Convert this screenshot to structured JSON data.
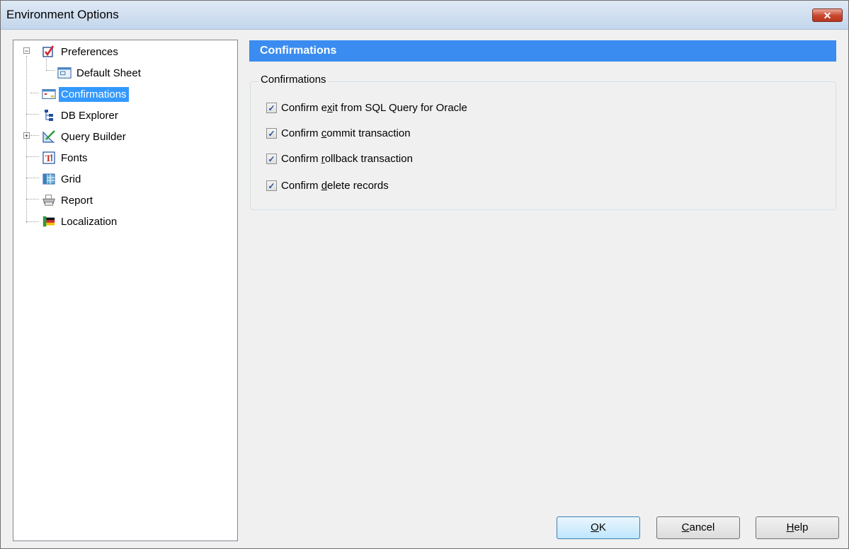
{
  "window": {
    "title": "Environment Options",
    "close_glyph": "✕"
  },
  "tree": {
    "items": [
      {
        "label": "Preferences",
        "icon": "checkbox-form-icon"
      },
      {
        "label": "Default Sheet",
        "icon": "sheet-window-icon"
      },
      {
        "label": "Confirmations",
        "icon": "dialog-icon",
        "selected": true
      },
      {
        "label": "DB Explorer",
        "icon": "tree-structure-icon"
      },
      {
        "label": "Query Builder",
        "icon": "ruler-pencil-icon"
      },
      {
        "label": "Fonts",
        "icon": "font-icon"
      },
      {
        "label": "Grid",
        "icon": "grid-icon"
      },
      {
        "label": "Report",
        "icon": "printer-icon"
      },
      {
        "label": "Localization",
        "icon": "flag-icon"
      }
    ]
  },
  "panel": {
    "header": "Confirmations",
    "group_label": "Confirmations",
    "checkboxes": [
      {
        "pre": "Confirm e",
        "ul": "x",
        "post": "it from SQL Query for Oracle",
        "checked": true
      },
      {
        "pre": "Confirm ",
        "ul": "c",
        "post": "ommit transaction",
        "checked": true
      },
      {
        "pre": "Confirm ",
        "ul": "r",
        "post": "ollback transaction",
        "checked": true
      },
      {
        "pre": "Confirm ",
        "ul": "d",
        "post": "elete records",
        "checked": true
      }
    ]
  },
  "buttons": {
    "ok": {
      "ul": "O",
      "rest": "K"
    },
    "cancel": {
      "ul": "C",
      "rest": "ancel"
    },
    "help": {
      "ul": "H",
      "rest": "elp"
    }
  },
  "colors": {
    "accent": "#3a8cf0",
    "selection": "#3399ff",
    "close": "#c8452c"
  }
}
